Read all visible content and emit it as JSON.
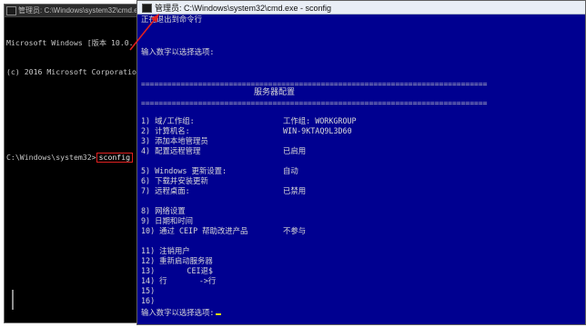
{
  "left_window": {
    "title": "管理员: C:\\Windows\\system32\\cmd.e",
    "lines": [
      "Microsoft Windows [版本 10.0.",
      "(c) 2016 Microsoft Corporatio",
      "",
      ""
    ],
    "prompt": "C:\\Windows\\system32>",
    "command": "sconfig"
  },
  "right_window": {
    "title": "管理员: C:\\Windows\\system32\\cmd.exe - sconfig",
    "top_line": "正在退出到命令行",
    "prompt_top": "输入数字以选择选项:",
    "separator": "===============================================================================",
    "header": "服务器配置",
    "items": [
      {
        "label": "1) 域/工作组:",
        "value": "工作组: WORKGROUP"
      },
      {
        "label": "2) 计算机名:",
        "value": "WIN-9KTAQ9L3D60"
      },
      {
        "label": "3) 添加本地管理员",
        "value": ""
      },
      {
        "label": "4) 配置远程管理",
        "value": "已启用"
      },
      {
        "label": "",
        "value": ""
      },
      {
        "label": "5) Windows 更新设置:",
        "value": "自动"
      },
      {
        "label": "6) 下载并安装更新",
        "value": ""
      },
      {
        "label": "7) 远程桌面:",
        "value": "已禁用"
      },
      {
        "label": "",
        "value": ""
      },
      {
        "label": "8) 网络设置",
        "value": ""
      },
      {
        "label": "9) 日期和时间",
        "value": ""
      },
      {
        "label": "10) 通过 CEIP 帮助改进产品",
        "value": "不参与"
      },
      {
        "label": "",
        "value": ""
      },
      {
        "label": "11) 注销用户",
        "value": ""
      },
      {
        "label": "12) 重新启动服务器",
        "value": ""
      },
      {
        "label": "13)       CEI退$",
        "value": ""
      },
      {
        "label": "14) 行       ->行",
        "value": ""
      },
      {
        "label": "15)",
        "value": ""
      },
      {
        "label": "16)",
        "value": ""
      }
    ],
    "prompt_bottom": "输入数字以选择选项:"
  },
  "colors": {
    "cmd_blue": "#000090",
    "highlight_red": "#e02020",
    "cursor_yellow": "#e4e400"
  }
}
